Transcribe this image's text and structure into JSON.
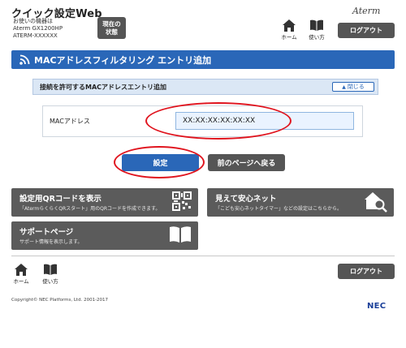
{
  "header": {
    "app_title": "クイック設定Web",
    "device_label": "お使いの機器は",
    "device_model": "Aterm GX1200HP",
    "device_id": "ATERM-XXXXXX",
    "status_button_line1": "現在の",
    "status_button_line2": "状態",
    "brand": "Aterm",
    "home_label": "ホーム",
    "help_label": "使い方",
    "logout_label": "ログアウト"
  },
  "section": {
    "title": "MACアドレスフィルタリング エントリ追加"
  },
  "panel": {
    "title": "接続を許可するMACアドレスエントリ追加",
    "close_label": "閉じる"
  },
  "form": {
    "mac_label": "MACアドレス",
    "mac_value": "XX:XX:XX:XX:XX:XX"
  },
  "actions": {
    "set_label": "設定",
    "back_label": "前のページへ戻る"
  },
  "tiles": [
    {
      "title": "設定用QRコードを表示",
      "description": "「AtermらくらくQRスタート」用のQRコードを作成できます。"
    },
    {
      "title": "見えて安心ネット",
      "description": "「こども安心ネットタイマー」などの設定はこちらから。"
    },
    {
      "title": "サポートページ",
      "description": "サポート情報を表示します。"
    }
  ],
  "footer": {
    "home_label": "ホーム",
    "help_label": "使い方",
    "logout_label": "ログアウト",
    "copyright": "Copyright© NEC Platforms, Ltd. 2001-2017",
    "logo": "NEC"
  },
  "colors": {
    "accent_blue": "#2a67b8",
    "dark_button": "#555555",
    "annotation_red": "#e0141e"
  },
  "icons": {
    "home": "home-icon",
    "help": "book-icon",
    "section": "wifi-icon",
    "qr": "qr-code-icon",
    "safe_net": "house-search-icon",
    "support": "book-icon"
  }
}
